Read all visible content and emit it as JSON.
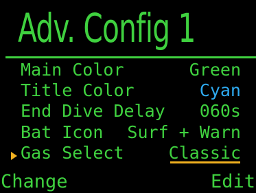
{
  "title": "Adv. Config 1",
  "colors": {
    "main": "#3fd13f",
    "title_color_value": "#2eaaf0",
    "selection": "#f0b020",
    "background": "#000000"
  },
  "settings": [
    {
      "label": "Main Color",
      "value": "Green"
    },
    {
      "label": "Title Color",
      "value": "Cyan"
    },
    {
      "label": "End Dive Delay",
      "value": "060s"
    },
    {
      "label": "Bat Icon",
      "value": "Surf + Warn"
    },
    {
      "label": "Gas Select",
      "value": "Classic",
      "selected": true
    }
  ],
  "softkeys": {
    "left": "Change",
    "right": "Edit"
  },
  "cursor_icon": "triangle-right-icon"
}
